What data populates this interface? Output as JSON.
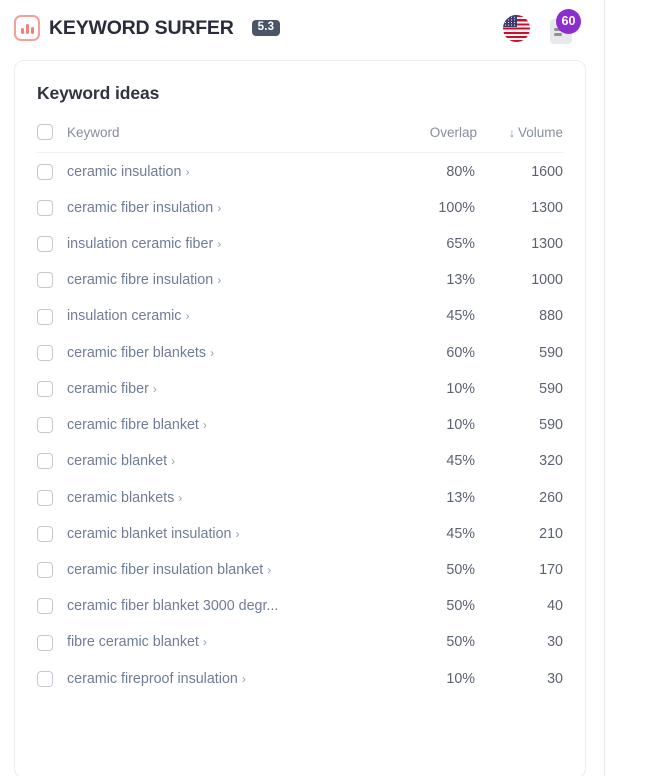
{
  "header": {
    "brand_name": "KEYWORD SURFER",
    "version": "5.3",
    "logo_icon": "bar-chart-logo-icon",
    "locale_icon": "us-flag-icon",
    "document_icon": "document-list-icon",
    "document_badge_count": "60",
    "badge_color": "#8b2ecd",
    "logo_color": "#ef8178"
  },
  "card": {
    "title": "Keyword ideas",
    "columns": {
      "keyword": "Keyword",
      "overlap": "Overlap",
      "volume": "Volume",
      "volume_sort_arrow": "↓"
    },
    "rows": [
      {
        "keyword": "ceramic insulation",
        "overlap": "80%",
        "volume": "1600",
        "chevron": "›",
        "truncated": false
      },
      {
        "keyword": "ceramic fiber insulation",
        "overlap": "100%",
        "volume": "1300",
        "chevron": "›",
        "truncated": false
      },
      {
        "keyword": "insulation ceramic fiber",
        "overlap": "65%",
        "volume": "1300",
        "chevron": "›",
        "truncated": false
      },
      {
        "keyword": "ceramic fibre insulation",
        "overlap": "13%",
        "volume": "1000",
        "chevron": "›",
        "truncated": false
      },
      {
        "keyword": "insulation ceramic",
        "overlap": "45%",
        "volume": "880",
        "chevron": "›",
        "truncated": false
      },
      {
        "keyword": "ceramic fiber blankets",
        "overlap": "60%",
        "volume": "590",
        "chevron": "›",
        "truncated": false
      },
      {
        "keyword": "ceramic fiber",
        "overlap": "10%",
        "volume": "590",
        "chevron": "›",
        "truncated": false
      },
      {
        "keyword": "ceramic fibre blanket",
        "overlap": "10%",
        "volume": "590",
        "chevron": "›",
        "truncated": false
      },
      {
        "keyword": "ceramic blanket",
        "overlap": "45%",
        "volume": "320",
        "chevron": "›",
        "truncated": false
      },
      {
        "keyword": "ceramic blankets",
        "overlap": "13%",
        "volume": "260",
        "chevron": "›",
        "truncated": false
      },
      {
        "keyword": "ceramic blanket insulation",
        "overlap": "45%",
        "volume": "210",
        "chevron": "›",
        "truncated": false
      },
      {
        "keyword": "ceramic fiber insulation blanket",
        "overlap": "50%",
        "volume": "170",
        "chevron": "›",
        "truncated": false
      },
      {
        "keyword": "ceramic fiber blanket 3000 degr...",
        "overlap": "50%",
        "volume": "40",
        "chevron": "",
        "truncated": true
      },
      {
        "keyword": "fibre ceramic blanket",
        "overlap": "50%",
        "volume": "30",
        "chevron": "›",
        "truncated": false
      },
      {
        "keyword": "ceramic fireproof insulation",
        "overlap": "10%",
        "volume": "30",
        "chevron": "›",
        "truncated": false
      }
    ]
  }
}
